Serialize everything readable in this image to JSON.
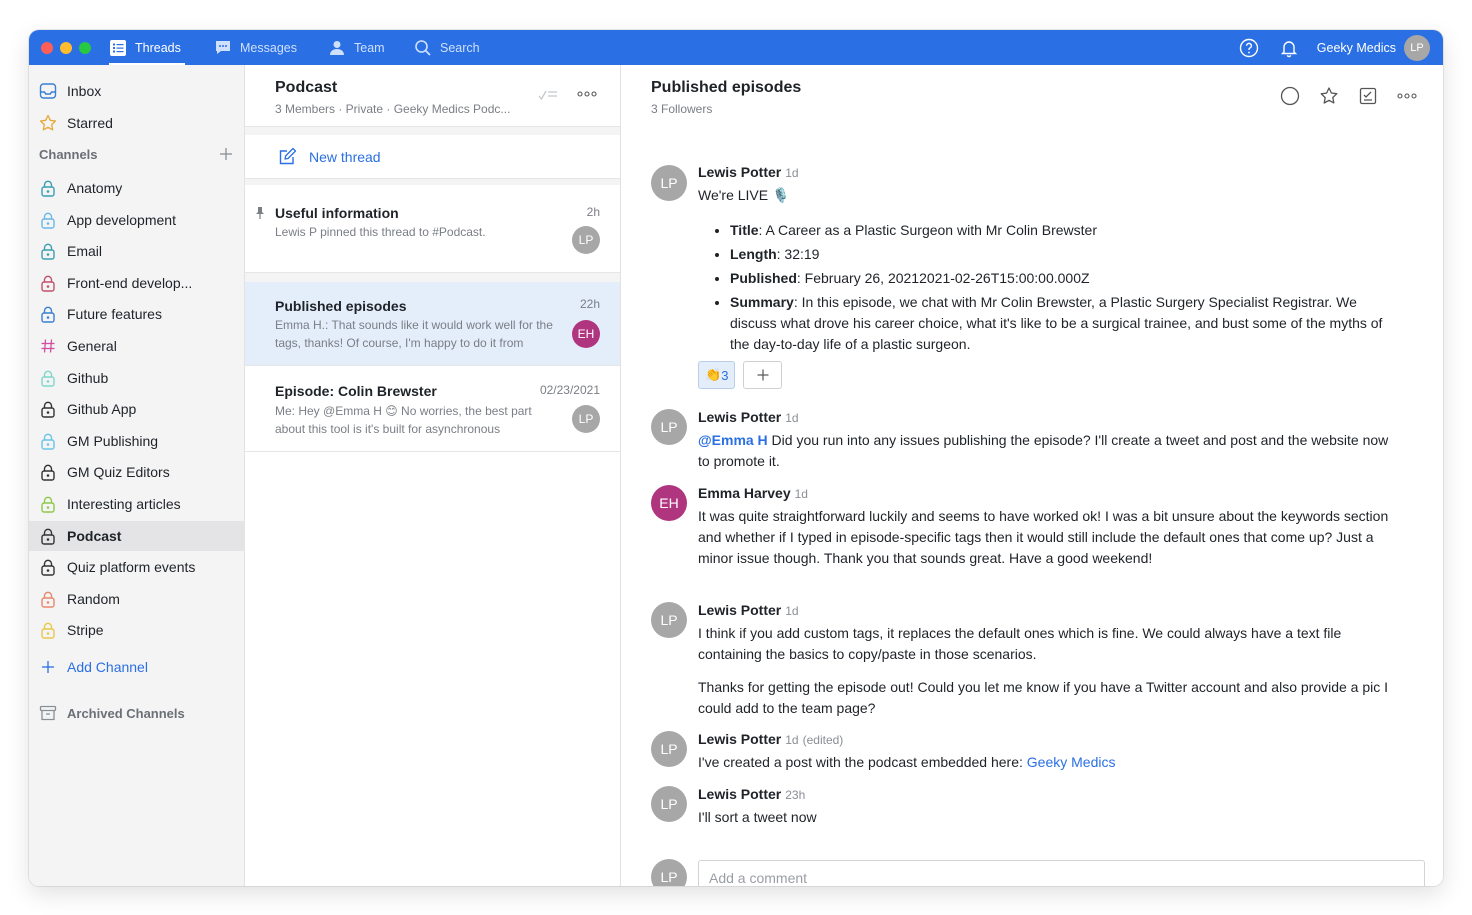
{
  "topbar": {
    "tabs": [
      {
        "label": "Threads",
        "icon": "threads-icon",
        "active": true
      },
      {
        "label": "Messages",
        "icon": "messages-icon",
        "active": false
      },
      {
        "label": "Team",
        "icon": "team-icon",
        "active": false
      },
      {
        "label": "Search",
        "icon": "search-icon",
        "active": false
      }
    ],
    "workspace_name": "Geeky Medics",
    "user_initials": "LP",
    "accent_color": "#2a6fe3"
  },
  "sidebar": {
    "top_items": [
      {
        "label": "Inbox",
        "icon": "inbox-icon"
      },
      {
        "label": "Starred",
        "icon": "star-icon"
      }
    ],
    "channels_heading": "Channels",
    "channels": [
      {
        "label": "Anatomy",
        "color": "#3a9fb0"
      },
      {
        "label": "App development",
        "color": "#6ab7e8"
      },
      {
        "label": "Email",
        "color": "#3a9fb0"
      },
      {
        "label": "Front-end develop...",
        "color": "#c0506a"
      },
      {
        "label": "Future features",
        "color": "#3a7fd0"
      },
      {
        "label": "General",
        "color": "#d14da0"
      },
      {
        "label": "Github",
        "color": "#7fd6c8"
      },
      {
        "label": "Github App",
        "color": "#333333"
      },
      {
        "label": "GM Publishing",
        "color": "#6ac4e8"
      },
      {
        "label": "GM Quiz Editors",
        "color": "#333333"
      },
      {
        "label": "Interesting articles",
        "color": "#8fc84a"
      },
      {
        "label": "Podcast",
        "color": "#333333",
        "active": true
      },
      {
        "label": "Quiz platform events",
        "color": "#333333"
      },
      {
        "label": "Random",
        "color": "#e8886a"
      },
      {
        "label": "Stripe",
        "color": "#e8c84a"
      }
    ],
    "add_channel": "Add Channel",
    "archived": "Archived Channels"
  },
  "threadlist": {
    "title": "Podcast",
    "subtitle": "3 Members · Private · Geeky Medics Podc...",
    "new_thread": "New thread",
    "threads": [
      {
        "title": "Useful information",
        "time": "2h",
        "preview": "Lewis P pinned this thread to #Podcast.",
        "avatar": "LP",
        "avatar_color": "#a7a7a7",
        "pinned": true
      },
      {
        "title": "Published episodes",
        "time": "22h",
        "preview": "Emma H.: That sounds like it would work well for the tags, thanks! Of course, I'm happy to do it from",
        "avatar": "EH",
        "avatar_color": "#b0357f",
        "active": true
      },
      {
        "title": "Episode: Colin Brewster",
        "time": "02/23/2021",
        "preview": "Me: Hey @Emma H 😊 No worries, the best part about this tool is it's built for asynchronous",
        "avatar": "LP",
        "avatar_color": "#a7a7a7"
      }
    ]
  },
  "main": {
    "title": "Published episodes",
    "followers": "3 Followers",
    "messages": [
      {
        "author": "Lewis Potter",
        "time": "1d",
        "avatar": "LP",
        "text": "We're LIVE 🎙️",
        "bullets": [
          {
            "key": "Title",
            "value": ": A Career as a Plastic Surgeon with Mr Colin Brewster"
          },
          {
            "key": "Length",
            "value": ": 32:19"
          },
          {
            "key": "Published",
            "value": ": February 26, 20212021-02-26T15:00:00.000Z"
          },
          {
            "key": "Summary",
            "value": ": In this episode, we chat with Mr Colin Brewster, a Plastic Surgery Specialist Registrar. We discuss what drove his career choice, what it's like to be a surgical trainee, and bust some of the myths of the day-to-day life of a plastic surgeon."
          }
        ],
        "reaction_emoji": "👏",
        "reaction_count": "3"
      },
      {
        "author": "Lewis Potter",
        "time": "1d",
        "avatar": "LP",
        "mention": "@Emma H",
        "text": " Did you run into any issues publishing the episode? I'll create a tweet and post and the website now to promote it."
      },
      {
        "author": "Emma Harvey",
        "time": "1d",
        "avatar": "EH",
        "text": "It was quite straightforward luckily and seems to have worked ok! I was a bit unsure about the keywords section and whether if I typed in episode-specific tags then it would still include the default ones that come up? Just a minor issue though. Thank you that sounds great. Have a good weekend!"
      },
      {
        "author": "Lewis Potter",
        "time": "1d",
        "avatar": "LP",
        "text": "I think if you add custom tags, it replaces the default ones which is fine. We could always have a text file containing the basics to copy/paste in those scenarios.",
        "text2": "Thanks for getting the episode out! Could you let me know if you have a Twitter account and also provide a pic I could add to the team page?"
      },
      {
        "author": "Lewis Potter",
        "time": "1d",
        "edited": "(edited)",
        "avatar": "LP",
        "text": "I've created a post with the podcast embedded here: ",
        "link": "Geeky Medics"
      },
      {
        "author": "Lewis Potter",
        "time": "23h",
        "avatar": "LP",
        "text": "I'll sort a tweet now"
      }
    ],
    "comment_placeholder": "Add a comment",
    "comment_avatar": "LP"
  }
}
